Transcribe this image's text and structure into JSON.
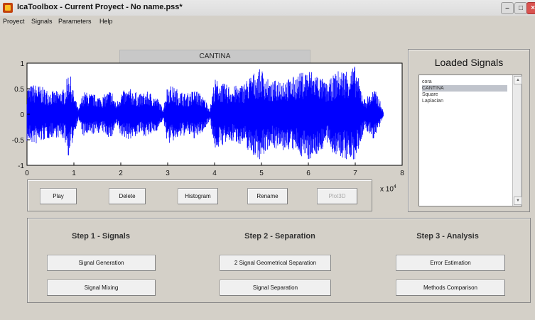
{
  "window": {
    "title": "IcaToolbox - Current Proyect - No name.pss*"
  },
  "menu": [
    "Proyect",
    "Signals",
    "Parameters",
    "Help"
  ],
  "plot": {
    "title": "CANTINA",
    "x_ticks": [
      "0",
      "1",
      "2",
      "3",
      "4",
      "5",
      "6",
      "7",
      "8"
    ],
    "y_ticks": [
      "1",
      "0.5",
      "0",
      "-0.5",
      "-1"
    ],
    "exponent_base": "x 10",
    "exponent": "4",
    "waveform_color": "#0000ff"
  },
  "chart_data": {
    "type": "line",
    "title": "CANTINA",
    "xlim": [
      0,
      80000
    ],
    "ylim": [
      -1,
      1
    ],
    "x_multiplier": "x 10^4",
    "series": [
      {
        "envelope_points_x": [
          0,
          2000,
          4000,
          6000,
          8000,
          9000,
          10000,
          11000,
          12000,
          14000,
          16000,
          18000,
          19000,
          20000,
          22000,
          24000,
          26000,
          28000,
          29000,
          30000,
          32000,
          34000,
          36000,
          38000,
          39000,
          40000,
          42000,
          44000,
          46000,
          48000,
          50000,
          52000,
          54000,
          56000,
          58000,
          60000,
          62000,
          64000,
          66000,
          68000,
          70000,
          71000,
          72000,
          74000,
          75000,
          76000
        ],
        "envelope_amplitude": [
          0.55,
          0.6,
          0.5,
          0.45,
          0.5,
          0.9,
          0.4,
          0.1,
          0.45,
          0.4,
          0.35,
          0.5,
          0.2,
          0.45,
          0.5,
          0.4,
          0.45,
          0.3,
          0.1,
          0.6,
          0.5,
          0.4,
          0.5,
          0.3,
          0.1,
          0.7,
          0.6,
          0.55,
          0.6,
          0.8,
          0.9,
          0.6,
          0.75,
          0.7,
          0.8,
          0.9,
          0.8,
          0.6,
          0.85,
          0.9,
          0.95,
          0.6,
          0.3,
          0.5,
          0.35,
          0.05
        ]
      }
    ]
  },
  "buttons": {
    "play": "Play",
    "delete": "Delete",
    "histogram": "Histogram",
    "rename": "Rename",
    "plot3d": "Plot3D"
  },
  "loaded_signals": {
    "title": "Loaded Signals",
    "items": [
      "cora",
      "CANTINA",
      "Square",
      "Laplacian"
    ],
    "selected_index": 1
  },
  "steps": {
    "step1": {
      "title": "Step 1 - Signals",
      "btn1": "Signal Generation",
      "btn2": "Signal Mixing"
    },
    "step2": {
      "title": "Step 2 - Separation",
      "btn1": "2 Signal Geometrical Separation",
      "btn2": "Signal Separation"
    },
    "step3": {
      "title": "Step 3 - Analysis",
      "btn1": "Error Estimation",
      "btn2": "Methods Comparison"
    }
  }
}
